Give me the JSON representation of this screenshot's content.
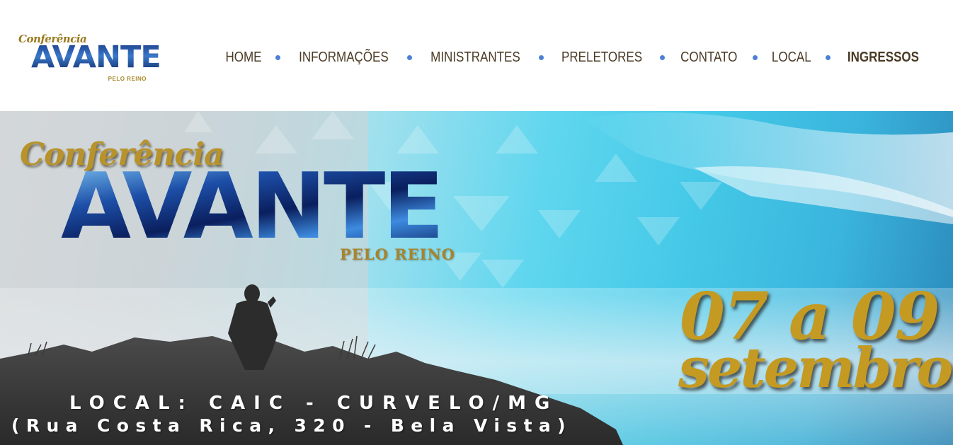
{
  "header": {
    "logo": {
      "script": "Conferência",
      "title": "AVANTE",
      "subtitle": "PELO REINO"
    },
    "nav": [
      {
        "label": "HOME"
      },
      {
        "label": "INFORMAÇÕES"
      },
      {
        "label": "MINISTRANTES"
      },
      {
        "label": "PRELETORES"
      },
      {
        "label": "CONTATO"
      },
      {
        "label": "LOCAL"
      },
      {
        "label": "INGRESSOS"
      }
    ]
  },
  "hero": {
    "script": "Conferência",
    "title": "AVANTE",
    "subtitle": "PELO REINO",
    "dates": "07 a 09",
    "month": "setembro",
    "location": "LOCAL: CAIC - CURVELO/MG",
    "address": "(Rua Costa Rica, 320 - Bela Vista)"
  },
  "colors": {
    "nav_text": "#4a3a24",
    "nav_dot": "#4f7fd6",
    "gold": "#c49a22",
    "sky": "#45c9e8"
  }
}
